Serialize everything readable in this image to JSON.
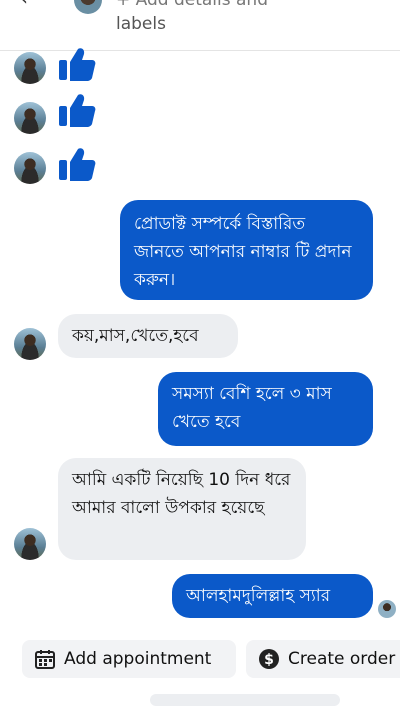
{
  "header": {
    "back_icon": "arrow-left-icon",
    "title_line1": "+ Add details and",
    "title_line2": "labels"
  },
  "likes": [
    "like-thumb-icon",
    "like-thumb-icon",
    "like-thumb-icon"
  ],
  "messages": [
    {
      "direction": "out",
      "text": "প্রোডাক্ট সম্পর্কে বিস্তারিত জানতে আপনার নাম্বার টি প্রদান করুন।"
    },
    {
      "direction": "in",
      "text": "কয়,মাস,খেতে,হবে"
    },
    {
      "direction": "out",
      "text": "সমস্যা বেশি হলে ৩ মাস খেতে হবে"
    },
    {
      "direction": "in",
      "text": "আমি একটি নিয়েছি 10 দিন ধরে আমার বালো উপকার হয়েছে"
    },
    {
      "direction": "out",
      "text": "আলহামদুলিল্লাহ স্যার"
    }
  ],
  "actions": {
    "appointment": {
      "label": "Add appointment",
      "icon": "calendar-icon"
    },
    "order": {
      "label": "Create order",
      "icon": "dollar-icon"
    }
  },
  "colors": {
    "outgoing": "#0b59c9",
    "incoming": "#eceef1",
    "like": "#0b59c9"
  }
}
